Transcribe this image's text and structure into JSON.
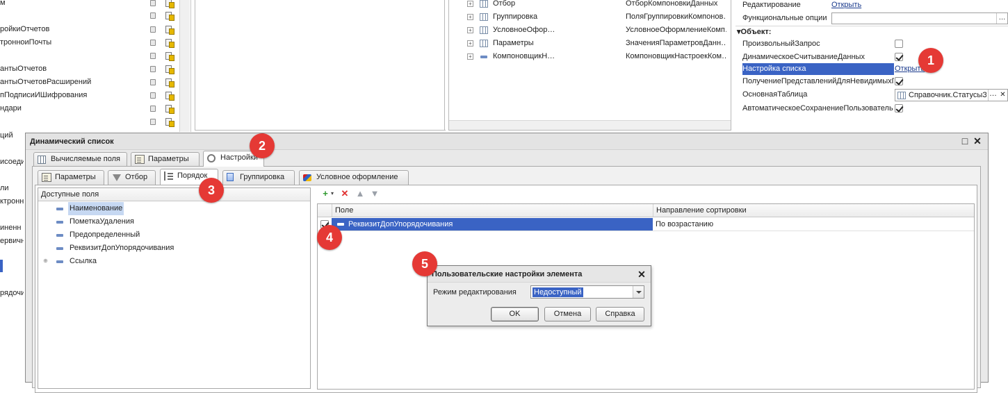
{
  "left_list": {
    "items": [
      "м",
      "",
      "ройкиОтчетов",
      "тронноиПочты",
      "",
      "антыОтчетов",
      "антыОтчетовРасширений",
      "пПодписиИШифрования",
      "ндари"
    ]
  },
  "left_fragments": {
    "items": [
      "ций",
      "исоеди",
      "",
      "ли",
      "ктронн",
      "",
      "иненн",
      "ервичн",
      "",
      "рядочи"
    ]
  },
  "tree": {
    "rows": [
      {
        "name": "Отбор",
        "type": "ОтборКомпоновкиДанных"
      },
      {
        "name": "Группировка",
        "type": "ПоляГруппировкиКомпонов…"
      },
      {
        "name": "УсловноеОфор…",
        "type": "УсловноеОформлениеКомп…"
      },
      {
        "name": "Параметры",
        "type": "ЗначенияПараметровДанн…"
      },
      {
        "name": "КомпоновщикН…",
        "type": "КомпоновщикНастроекКом…"
      }
    ]
  },
  "props": {
    "edit_label": "Редактирование",
    "edit_link": "Открыть",
    "func_label": "Функциональные опции",
    "section": "Объект:",
    "rows": [
      {
        "label": "ПроизвольныйЗапрос",
        "checked": false
      },
      {
        "label": "ДинамическоеСчитываниеДанных",
        "checked": true
      },
      {
        "label": "Настройка списка",
        "link": "Открыть"
      },
      {
        "label": "ПолучениеПредставленийДляНевидимыхП",
        "checked": true
      },
      {
        "label": "ОсновнаяТаблица",
        "value": "Справочник.СтатусыЗ"
      },
      {
        "label": "АвтоматическоеСохранениеПользователь",
        "checked": true
      }
    ]
  },
  "markers": [
    "1",
    "2",
    "3",
    "4",
    "5"
  ],
  "dialog": {
    "title": "Динамический список",
    "tabs": [
      "Вычисляемые поля",
      "Параметры",
      "Настройки"
    ],
    "subtabs": [
      "Параметры",
      "Отбор",
      "Порядок",
      "Группировка",
      "Условное оформление"
    ],
    "available_header": "Доступные поля",
    "fields": [
      "Наименование",
      "ПометкаУдаления",
      "Предопределенный",
      "РеквизитДопУпорядочивания",
      "Ссылка"
    ],
    "order_headers": [
      "Поле",
      "Направление сортировки"
    ],
    "order_rows": [
      {
        "field": "РеквизитДопУпорядочивания",
        "direction": "По возрастанию",
        "checked": true
      }
    ]
  },
  "popup": {
    "title": "Пользовательские настройки элемента",
    "mode_label": "Режим редактирования",
    "mode_value": "Недоступный",
    "ok": "OK",
    "cancel": "Отмена",
    "help": "Справка"
  },
  "colors": {
    "selection": "#3a63c4",
    "marker": "#e53935"
  }
}
